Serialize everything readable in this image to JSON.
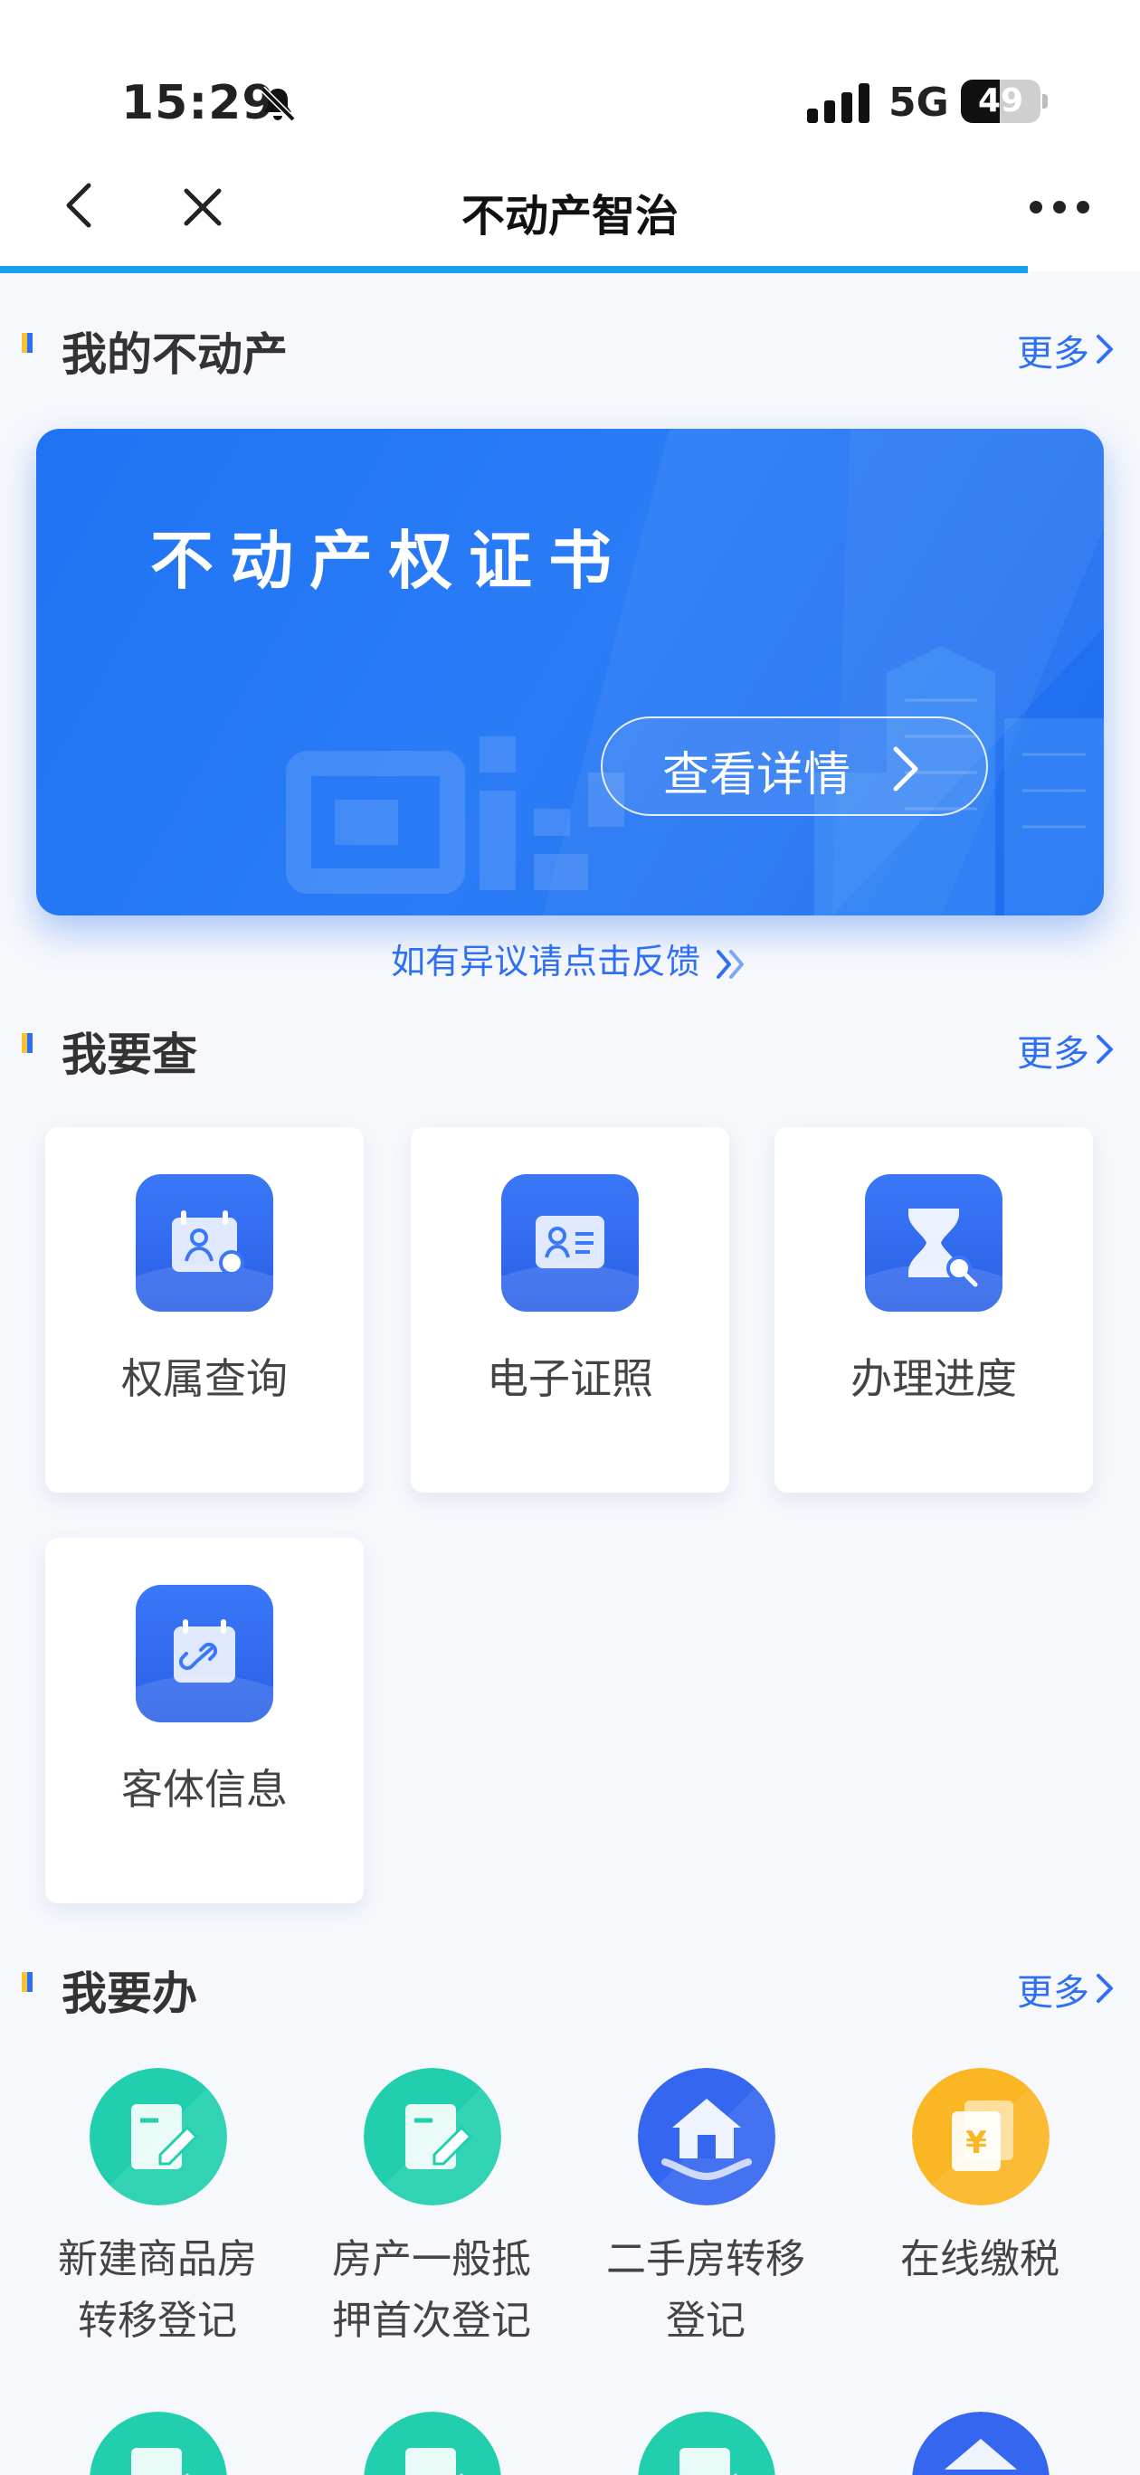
{
  "status_bar": {
    "time": "15:29",
    "network": "5G",
    "battery": "49",
    "battery_level": 0.49
  },
  "nav": {
    "title": "不动产智治"
  },
  "my_property": {
    "title": "我的不动产",
    "more": "更多",
    "card_title": "不动产权证书",
    "card_button": "查看详情",
    "feedback": "如有异议请点击反馈"
  },
  "query": {
    "title": "我要查",
    "more": "更多",
    "items": [
      {
        "label": "权属查询",
        "icon": "ownership-search-icon"
      },
      {
        "label": "电子证照",
        "icon": "id-card-icon"
      },
      {
        "label": "办理进度",
        "icon": "hourglass-search-icon"
      },
      {
        "label": "客体信息",
        "icon": "calendar-link-icon"
      }
    ]
  },
  "services": {
    "title": "我要办",
    "more": "更多",
    "items": [
      {
        "line1": "新建商品房",
        "line2": "转移登记",
        "icon": "edit-form-icon",
        "color": "#21cfae"
      },
      {
        "line1": "房产一般抵",
        "line2": "押首次登记",
        "icon": "edit-form-icon",
        "color": "#21cfae"
      },
      {
        "line1": "二手房转移",
        "line2": "登记",
        "icon": "house-hand-icon",
        "color": "#3566f0"
      },
      {
        "line1": "在线缴税",
        "line2": "",
        "icon": "yuan-document-icon",
        "color": "#fbb623"
      }
    ]
  },
  "colors": {
    "accent": "#2f6ff3",
    "progress": "#1a9ef0",
    "teal": "#21cfae",
    "gold": "#fbb623"
  }
}
